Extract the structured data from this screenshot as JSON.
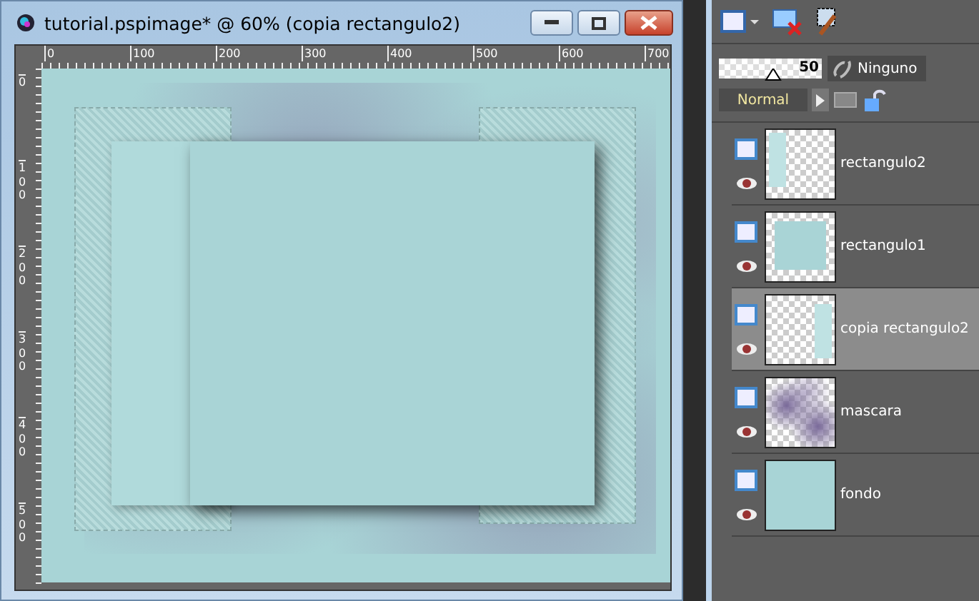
{
  "window": {
    "title": "tutorial.pspimage* @  60% (copia rectangulo2)"
  },
  "ruler": {
    "horizontal": [
      "0",
      "100",
      "200",
      "300",
      "400",
      "500",
      "600",
      "700"
    ],
    "vertical": [
      "0",
      "100",
      "200",
      "300",
      "400",
      "500"
    ]
  },
  "layers_panel": {
    "opacity": {
      "level": 0.5,
      "reading": "50"
    },
    "mask_button": "Ninguno",
    "blend_mode": "Normal",
    "layers": [
      {
        "name": "rectangulo2",
        "selected": false,
        "kind": "left-strip"
      },
      {
        "name": "rectangulo1",
        "selected": false,
        "kind": "rect"
      },
      {
        "name": "copia rectangulo2",
        "selected": true,
        "kind": "right-strip"
      },
      {
        "name": "mascara",
        "selected": false,
        "kind": "texture"
      },
      {
        "name": "fondo",
        "selected": false,
        "kind": "fill"
      }
    ]
  }
}
